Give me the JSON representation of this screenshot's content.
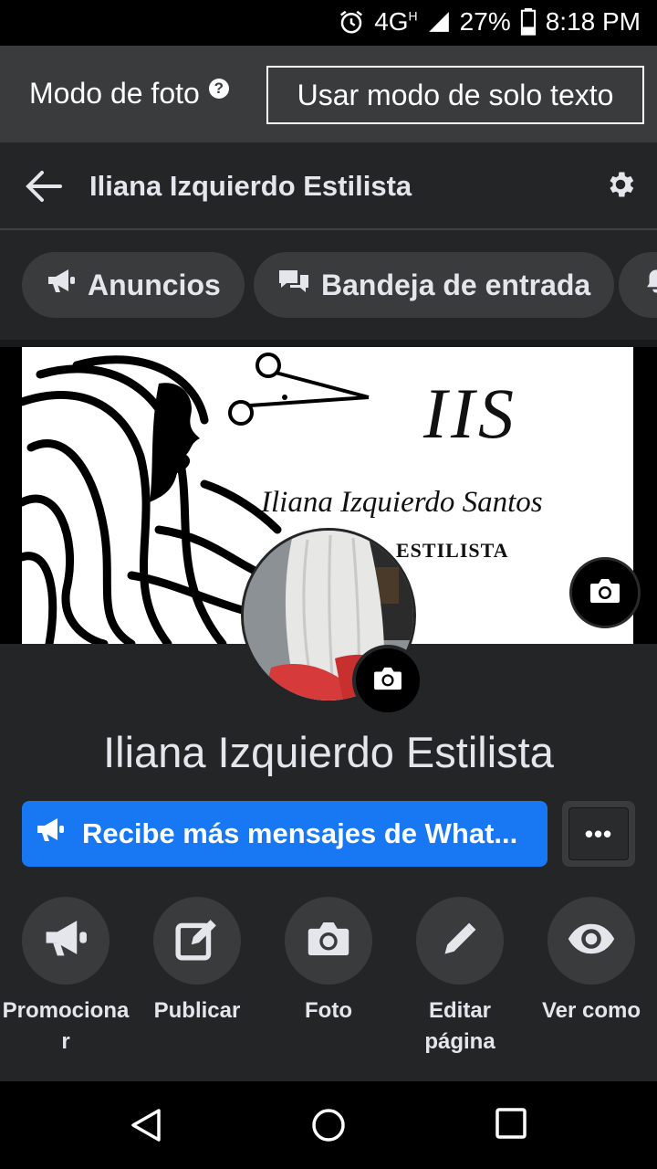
{
  "status_bar": {
    "network": "4G",
    "network_sup": "H",
    "battery": "27%",
    "time": "8:18 PM"
  },
  "mode_bar": {
    "label": "Modo de foto",
    "help_icon": "?",
    "text_mode_button": "Usar modo de solo texto"
  },
  "header": {
    "title": "Iliana Izquierdo Estilista"
  },
  "chips": [
    {
      "label": "Anuncios",
      "icon": "megaphone-icon"
    },
    {
      "label": "Bandeja de entrada",
      "icon": "chat-bubbles-icon"
    },
    {
      "label": "",
      "icon": "bell-icon"
    }
  ],
  "cover": {
    "logo_initials": "IIS",
    "logo_name": "Iliana Izquierdo Santos",
    "logo_subtitle": "ESTILISTA"
  },
  "profile": {
    "name": "Iliana Izquierdo Estilista"
  },
  "promo": {
    "label": "Recibe más mensajes de What..."
  },
  "more_button": {
    "label": "•••"
  },
  "actions": [
    {
      "label": "Promociona r",
      "line1": "Promociona",
      "line2": "r",
      "icon": "megaphone-icon"
    },
    {
      "label": "Publicar",
      "line1": "Publicar",
      "line2": "",
      "icon": "edit-square-icon"
    },
    {
      "label": "Foto",
      "line1": "Foto",
      "line2": "",
      "icon": "camera-icon"
    },
    {
      "label": "Editar página",
      "line1": "Editar",
      "line2": "página",
      "icon": "pencil-icon"
    },
    {
      "label": "Ver como",
      "line1": "Ver como",
      "line2": "",
      "icon": "eye-icon"
    }
  ],
  "colors": {
    "background": "#242526",
    "surface": "#3a3b3c",
    "accent": "#1877f2",
    "text": "#e4e6eb"
  }
}
